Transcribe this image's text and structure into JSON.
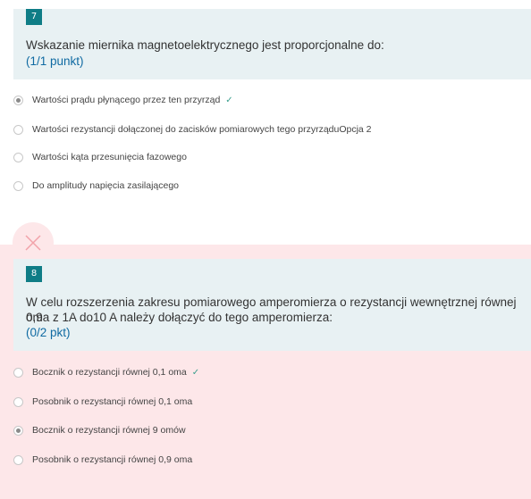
{
  "question7": {
    "number": "7",
    "text": "Wskazanie miernika magnetoelektrycznego jest proporcjonalne do:",
    "points": "(1/1 punkt)",
    "options": [
      {
        "label": "Wartości prądu płynącego przez ten przyrząd",
        "selected": true,
        "correct": true
      },
      {
        "label": "Wartości rezystancji dołączonej do zacisków pomiarowych tego przyrząduOpcja 2",
        "selected": false,
        "correct": false
      },
      {
        "label": "Wartości kąta przesunięcia fazowego",
        "selected": false,
        "correct": false
      },
      {
        "label": "Do amplitudy napięcia zasilającego",
        "selected": false,
        "correct": false
      }
    ]
  },
  "question8": {
    "number": "8",
    "text_line1": "W celu rozszerzenia zakresu pomiarowego amperomierza o rezystancji wewnętrznej równej 0,9",
    "text_line2": "oma z 1A do10 A należy dołączyć do tego amperomierza:",
    "points": "(0/2 pkt)",
    "status_icon": "close-icon",
    "options": [
      {
        "label": "Bocznik o rezystancji równej 0,1 oma",
        "selected": false,
        "correct": true
      },
      {
        "label": "Posobnik o rezystancji równej 0,1 oma",
        "selected": false,
        "correct": false
      },
      {
        "label": "Bocznik o rezystancji równej 9 omów",
        "selected": true,
        "correct": false
      },
      {
        "label": "Posobnik o rezystancji równej 0,9 oma",
        "selected": false,
        "correct": false
      }
    ]
  },
  "colors": {
    "header_bg": "#e8f1f3",
    "number_badge": "#0f7d86",
    "incorrect_bg": "#fde7e9",
    "incorrect_icon": "#f2a3aa",
    "points_text": "#0f6aa2",
    "correct_check": "#3a9e8d"
  },
  "check_symbol": "✓"
}
